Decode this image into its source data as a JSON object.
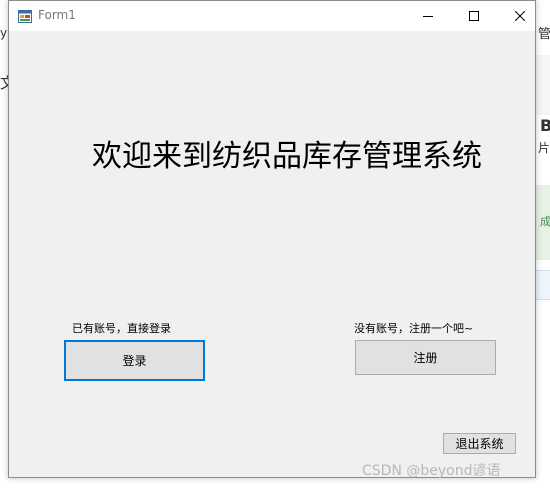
{
  "window": {
    "title": "Form1"
  },
  "main": {
    "welcome_title": "欢迎来到纺织品库存管理系统",
    "login_hint": "已有账号，直接登录",
    "register_hint": "没有账号，注册一个吧~",
    "login_button": "登录",
    "register_button": "注册",
    "exit_button": "退出系统"
  },
  "background": {
    "fragment_y": "y",
    "fragment_wen": "文",
    "fragment_guan": "管",
    "fragment_b": "B",
    "fragment_pian": "片",
    "fragment_cheng": "成"
  },
  "watermark": {
    "text": "CSDN @beyond谚语"
  },
  "colors": {
    "accent": "#0078d7",
    "button_face": "#e1e1e1",
    "form_back": "#f0f0f0"
  },
  "icons": {
    "app": "winforms-app-icon",
    "minimize": "minimize-icon",
    "maximize": "maximize-icon",
    "close": "close-icon"
  }
}
